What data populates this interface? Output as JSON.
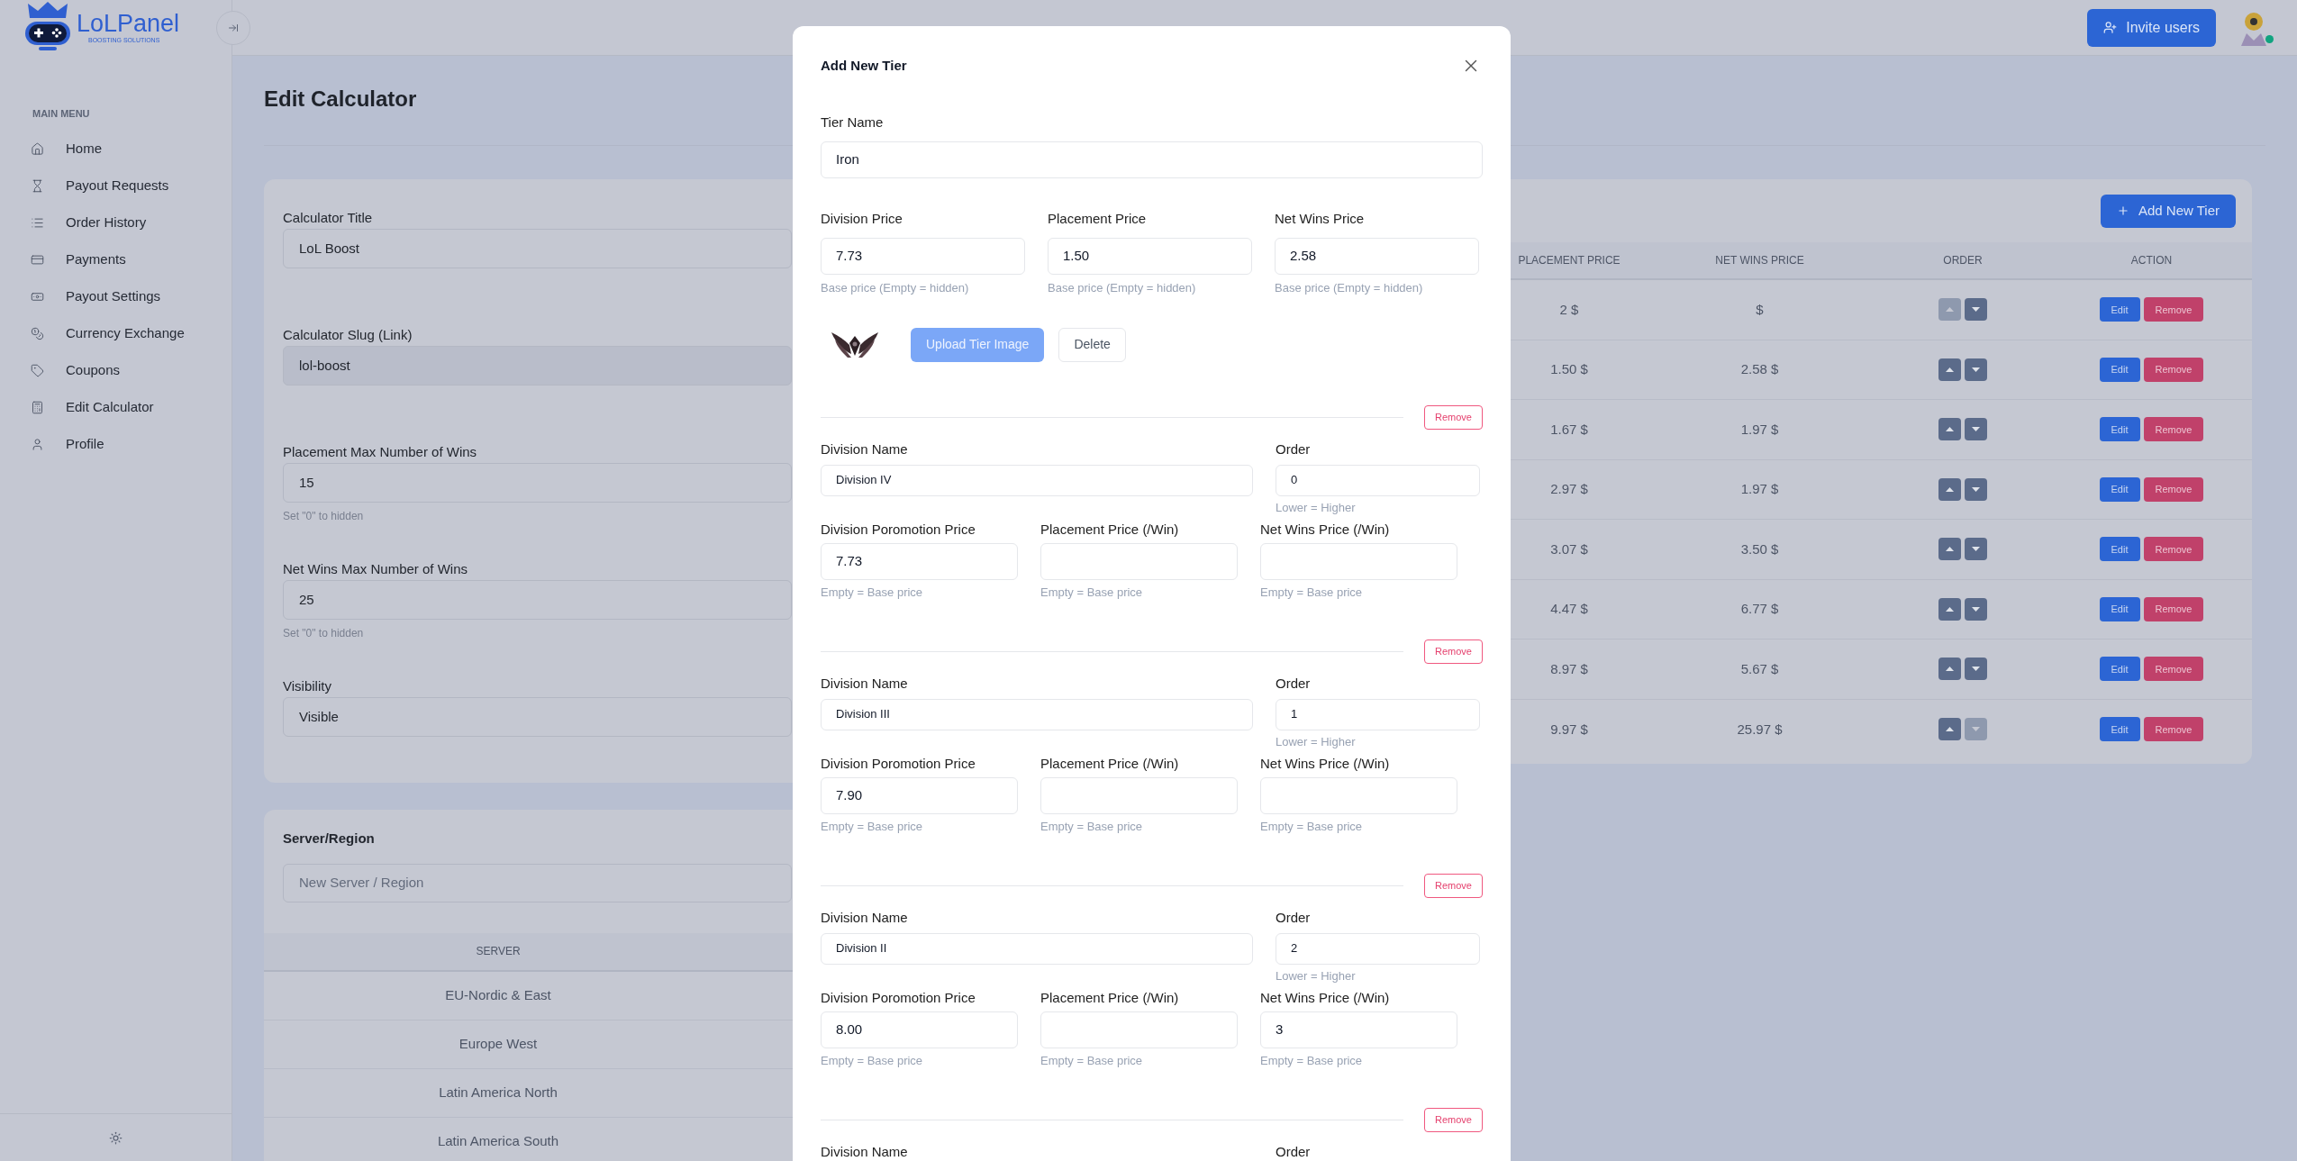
{
  "sidebar": {
    "logo": {
      "name": "LoLPanel",
      "tagline": "BOOSTING SOLUTIONS"
    },
    "section_title": "MAIN MENU",
    "items": [
      {
        "label": "Home",
        "selected": false
      },
      {
        "label": "Payout Requests",
        "selected": false
      },
      {
        "label": "Order History",
        "selected": false
      },
      {
        "label": "Payments",
        "selected": false
      },
      {
        "label": "Payout Settings",
        "selected": false
      },
      {
        "label": "Currency Exchange",
        "selected": false
      },
      {
        "label": "Coupons",
        "selected": false
      },
      {
        "label": "Edit Calculator",
        "selected": false
      },
      {
        "label": "Profile",
        "selected": false
      }
    ]
  },
  "topbar": {
    "invite_button": "Invite users",
    "online": true
  },
  "page": {
    "title": "Edit Calculator"
  },
  "calculator_form": {
    "fields": [
      {
        "label": "Calculator Title",
        "value": "LoL Boost",
        "readonly": false
      },
      {
        "label": "Calculator Slug (Link)",
        "value": "lol-boost",
        "readonly": true
      },
      {
        "label": "Placement Max Number of Wins",
        "value": "15",
        "readonly": false,
        "hint": "Set \"0\" to hidden"
      },
      {
        "label": "Net Wins Max Number of Wins",
        "value": "25",
        "readonly": false,
        "hint": "Set \"0\" to hidden"
      },
      {
        "label": "Visibility",
        "value": "Visible",
        "readonly": false
      }
    ]
  },
  "server_region": {
    "title": "Server/Region",
    "placeholder": "New Server / Region",
    "column": "SERVER",
    "rows": [
      "EU-Nordic & East",
      "Europe West",
      "Latin America North",
      "Latin America South"
    ]
  },
  "tiers_table": {
    "add_button": "Add New Tier",
    "columns": [
      "PLACEMENT PRICE",
      "NET WINS PRICE",
      "ORDER",
      "ACTION"
    ],
    "rows": [
      {
        "placement": "2 $",
        "net_wins": "$",
        "up_disabled": true,
        "down_disabled": false,
        "edit": "Edit",
        "remove": "Remove"
      },
      {
        "placement": "1.50 $",
        "net_wins": "2.58 $",
        "up_disabled": false,
        "down_disabled": false,
        "edit": "Edit",
        "remove": "Remove"
      },
      {
        "placement": "1.67 $",
        "net_wins": "1.97 $",
        "up_disabled": false,
        "down_disabled": false,
        "edit": "Edit",
        "remove": "Remove"
      },
      {
        "placement": "2.97 $",
        "net_wins": "1.97 $",
        "up_disabled": false,
        "down_disabled": false,
        "edit": "Edit",
        "remove": "Remove"
      },
      {
        "placement": "3.07 $",
        "net_wins": "3.50 $",
        "up_disabled": false,
        "down_disabled": false,
        "edit": "Edit",
        "remove": "Remove"
      },
      {
        "placement": "4.47 $",
        "net_wins": "6.77 $",
        "up_disabled": false,
        "down_disabled": false,
        "edit": "Edit",
        "remove": "Remove"
      },
      {
        "placement": "8.97 $",
        "net_wins": "5.67 $",
        "up_disabled": false,
        "down_disabled": false,
        "edit": "Edit",
        "remove": "Remove"
      },
      {
        "placement": "9.97 $",
        "net_wins": "25.97 $",
        "up_disabled": false,
        "down_disabled": true,
        "edit": "Edit",
        "remove": "Remove"
      }
    ]
  },
  "modal": {
    "title": "Add New Tier",
    "tier_name": {
      "label": "Tier Name",
      "value": "Iron"
    },
    "prices": [
      {
        "label": "Division Price",
        "value": "7.73",
        "hint": "Base price (Empty = hidden)"
      },
      {
        "label": "Placement Price",
        "value": "1.50",
        "hint": "Base price (Empty = hidden)"
      },
      {
        "label": "Net Wins Price",
        "value": "2.58",
        "hint": "Base price (Empty = hidden)"
      }
    ],
    "upload_button": {
      "label": "Upload Tier Image",
      "disabled": true
    },
    "delete_button": "Delete",
    "divisions": [
      {
        "remove": "Remove",
        "name_label": "Division Name",
        "name": "Division IV",
        "order_label": "Order",
        "order": "0",
        "order_hint": "Lower = Higher",
        "prices": [
          {
            "label": "Division Poromotion Price",
            "value": "7.73",
            "hint": "Empty = Base price"
          },
          {
            "label": "Placement Price (/Win)",
            "hint": "Empty = Base price"
          },
          {
            "label": "Net Wins Price (/Win)",
            "hint": "Empty = Base price"
          }
        ]
      },
      {
        "remove": "Remove",
        "name_label": "Division Name",
        "name": "Division III",
        "order_label": "Order",
        "order": "1",
        "order_hint": "Lower = Higher",
        "prices": [
          {
            "label": "Division Poromotion Price",
            "value": "7.90",
            "hint": "Empty = Base price"
          },
          {
            "label": "Placement Price (/Win)",
            "hint": "Empty = Base price"
          },
          {
            "label": "Net Wins Price (/Win)",
            "hint": "Empty = Base price"
          }
        ]
      },
      {
        "remove": "Remove",
        "name_label": "Division Name",
        "name": "Division II",
        "order_label": "Order",
        "order": "2",
        "order_hint": "Lower = Higher",
        "prices": [
          {
            "label": "Division Poromotion Price",
            "value": "8.00",
            "hint": "Empty = Base price"
          },
          {
            "label": "Placement Price (/Win)",
            "hint": "Empty = Base price"
          },
          {
            "label": "Net Wins Price (/Win)",
            "value": "3",
            "hint": "Empty = Base price"
          }
        ]
      },
      {
        "remove": "Remove",
        "name_label": "Division Name",
        "order_label": "Order"
      }
    ]
  }
}
